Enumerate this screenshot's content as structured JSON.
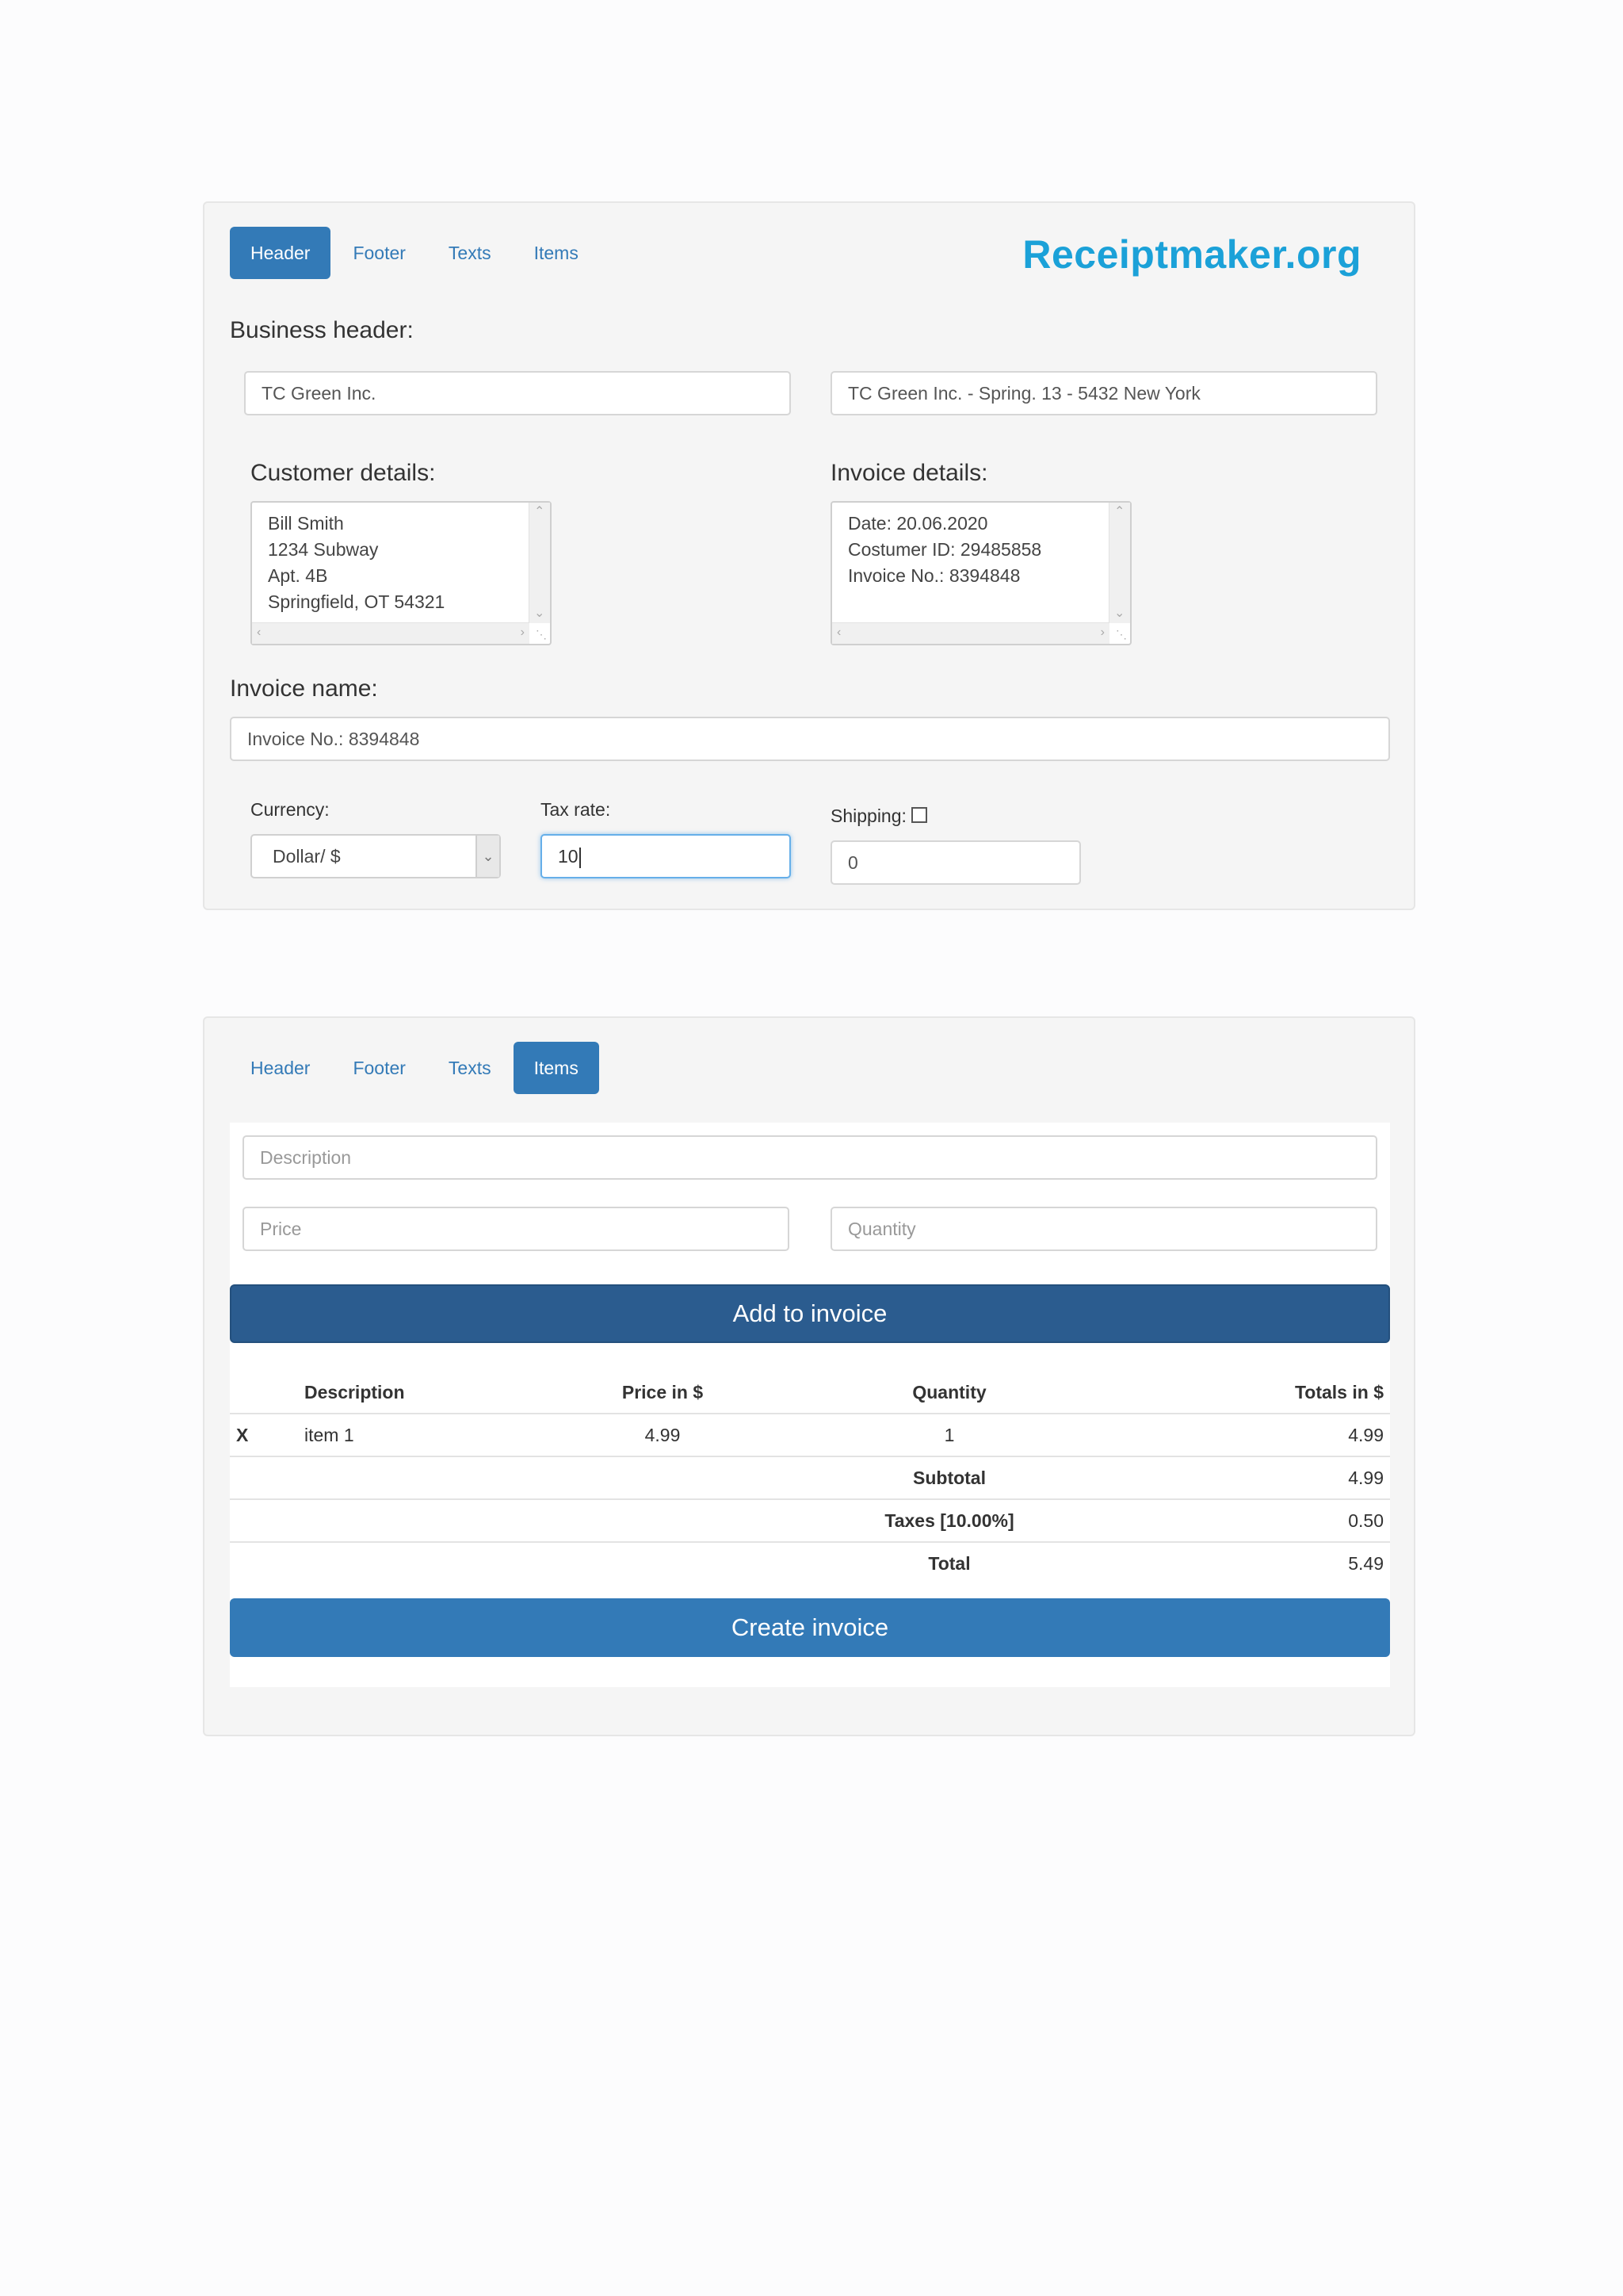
{
  "brand": "Receiptmaker.org",
  "tabs_top": [
    {
      "label": "Header",
      "active": true
    },
    {
      "label": "Footer",
      "active": false
    },
    {
      "label": "Texts",
      "active": false
    },
    {
      "label": "Items",
      "active": false
    }
  ],
  "header_form": {
    "business_header_label": "Business header:",
    "business_name": "TC Green Inc.",
    "business_address": "TC Green Inc. - Spring. 13 - 5432 New York",
    "customer_label": "Customer details:",
    "customer_lines": [
      "Bill Smith",
      "1234 Subway",
      "Apt. 4B",
      "Springfield, OT 54321"
    ],
    "invoice_details_label": "Invoice details:",
    "invoice_lines": [
      "Date: 20.06.2020",
      "Costumer ID: 29485858",
      "Invoice No.: 8394848"
    ],
    "invoice_name_label": "Invoice name:",
    "invoice_name": "Invoice No.: 8394848",
    "currency_label": "Currency:",
    "currency_value": "Dollar/ $",
    "tax_label": "Tax rate:",
    "tax_value": "10",
    "shipping_label": "Shipping:",
    "shipping_checked": false,
    "shipping_value": "0"
  },
  "tabs_bottom": [
    {
      "label": "Header",
      "active": false
    },
    {
      "label": "Footer",
      "active": false
    },
    {
      "label": "Texts",
      "active": false
    },
    {
      "label": "Items",
      "active": true
    }
  ],
  "items_form": {
    "description_placeholder": "Description",
    "price_placeholder": "Price",
    "quantity_placeholder": "Quantity",
    "add_button": "Add to invoice",
    "create_button": "Create invoice"
  },
  "table": {
    "headers": [
      "",
      "Description",
      "Price in $",
      "Quantity",
      "Totals in $"
    ],
    "rows": [
      {
        "remove": "X",
        "description": "item 1",
        "price": "4.99",
        "quantity": "1",
        "total": "4.99"
      }
    ],
    "subtotal_label": "Subtotal",
    "subtotal_value": "4.99",
    "taxes_label": "Taxes [10.00%]",
    "taxes_value": "0.50",
    "total_label": "Total",
    "total_value": "5.49"
  },
  "colors": {
    "primary": "#337ab7",
    "primary_dark": "#2b5c8f",
    "brand": "#1ba1d8",
    "panel_bg": "#f5f5f5"
  },
  "icons": {
    "scroll_up": "chevron-up-icon",
    "scroll_down": "chevron-down-icon",
    "scroll_left": "chevron-left-icon",
    "scroll_right": "chevron-right-icon",
    "select_arrow": "chevron-down-icon",
    "resize": "resize-grip-icon"
  }
}
